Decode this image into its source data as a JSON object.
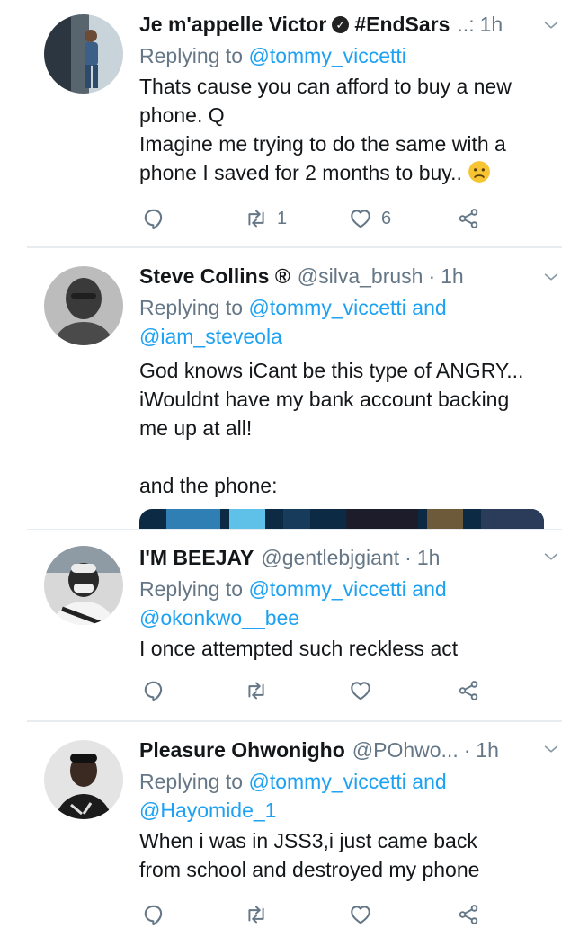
{
  "tweets": [
    {
      "name": "Je m'appelle Victor",
      "name_extra": "#EndSars",
      "handle": "",
      "dot": "..:",
      "time": "1h",
      "reply_prefix": "Replying to",
      "mention1": "@tommy_viccetti",
      "mention_join": "",
      "mention2": "",
      "lines": [
        "Thats cause you can afford to buy a new",
        "phone. Q",
        "Imagine me trying to do the same with a",
        "phone I saved for 2 months to buy.."
      ],
      "retweets": "1",
      "likes": "6"
    },
    {
      "name": "Steve Collins ®",
      "handle": "@silva_brush",
      "dot": "·",
      "time": "1h",
      "reply_prefix": "Replying to",
      "mention1": "@tommy_viccetti",
      "mention_join": "and",
      "mention2": "@iam_steveola",
      "lines": [
        "God knows iCant be this type of ANGRY...",
        "iWouldnt have my bank account backing",
        "me up at all!",
        "",
        "and the phone:"
      ],
      "retweets": "",
      "likes": ""
    },
    {
      "name": "I'M BEEJAY",
      "handle": "@gentlebjgiant",
      "dot": "·",
      "time": "1h",
      "reply_prefix": "Replying to",
      "mention1": "@tommy_viccetti",
      "mention_join": "and",
      "mention2": "@okonkwo__bee",
      "lines": [
        "I once attempted such reckless act"
      ],
      "retweets": "",
      "likes": ""
    },
    {
      "name": "Pleasure Ohwonigho",
      "handle": "@POhwo...",
      "dot": "·",
      "time": "1h",
      "reply_prefix": "Replying to",
      "mention1": "@tommy_viccetti",
      "mention_join": "and",
      "mention2": "@Hayomide_1",
      "lines": [
        "When i was in JSS3,i just came back",
        "from school and destroyed my phone"
      ],
      "retweets": "",
      "likes": ""
    }
  ],
  "icons": {
    "reply": "reply-icon",
    "retweet": "retweet-icon",
    "like": "heart-icon",
    "share": "share-icon",
    "more": "chevron-down-icon",
    "verified": "verified-badge-icon",
    "emoji": "worried-face-emoji"
  },
  "colors": {
    "link": "#1da1f2",
    "secondary": "#657786",
    "divider": "#e6ecf0"
  }
}
